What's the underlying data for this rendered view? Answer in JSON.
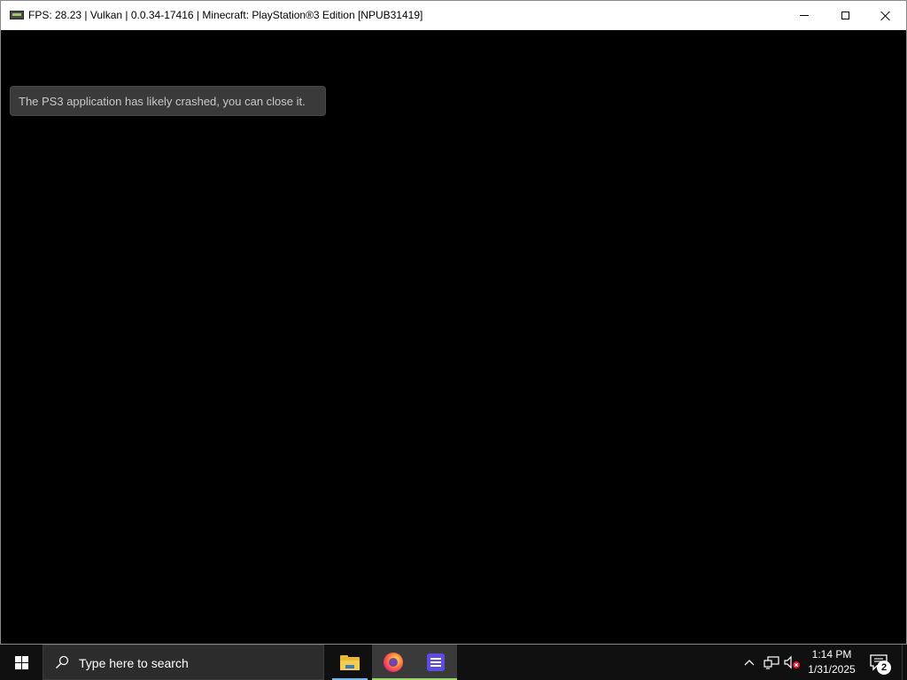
{
  "window": {
    "title": "FPS: 28.23 | Vulkan | 0.0.34-17416 | Minecraft: PlayStation®3 Edition [NPUB31419]",
    "app_icon": "rpcs3-app-icon",
    "controls": [
      "minimize",
      "maximize",
      "close"
    ]
  },
  "content": {
    "toast_message": "The PS3 application has likely crashed, you can close it."
  },
  "taskbar": {
    "search_placeholder": "Type here to search",
    "pinned_apps": [
      {
        "name": "File Explorer",
        "icon": "folder-icon"
      },
      {
        "name": "Firefox",
        "icon": "firefox-icon"
      },
      {
        "name": "RPCS3",
        "icon": "rpcs3-icon"
      }
    ],
    "tray": {
      "time": "1:14 PM",
      "date": "1/31/2025",
      "notification_count": "2"
    }
  },
  "colors": {
    "titlebar": "#ffffff",
    "taskbar": "#101010",
    "toast_bg": "#3a3a3a",
    "active_underline": "#9bd46b"
  }
}
